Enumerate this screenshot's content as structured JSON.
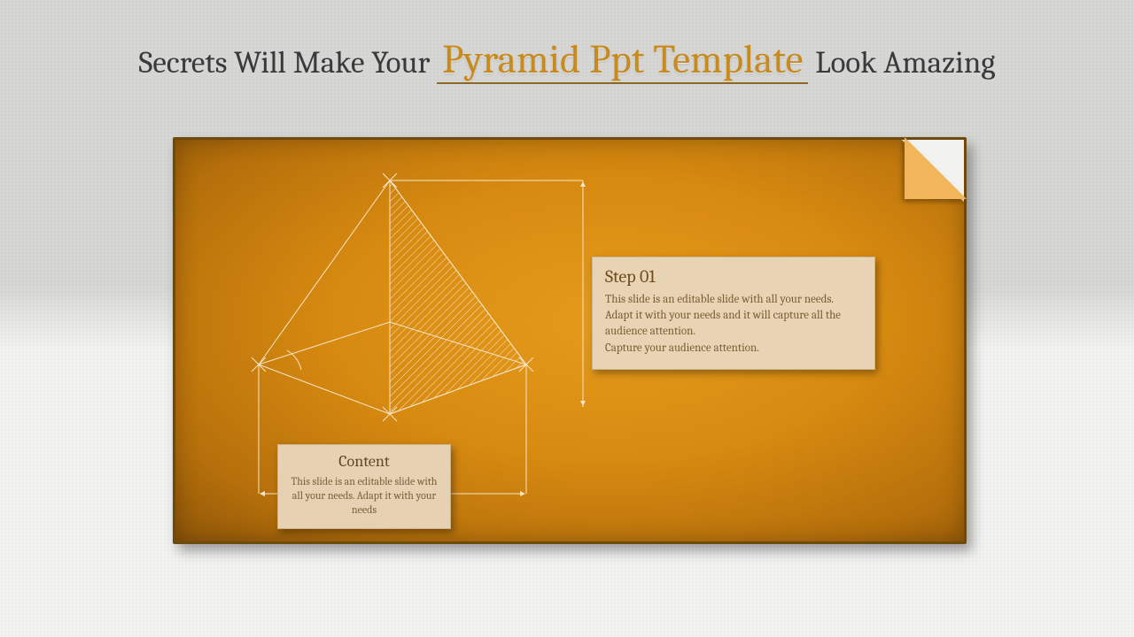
{
  "title": {
    "pre": "Secrets Will Make Your ",
    "accent": "Pyramid Ppt Template",
    "post": " Look Amazing"
  },
  "step": {
    "heading": "Step 01",
    "body": "This slide is an editable slide with all your needs.\nAdapt it with your needs and it will capture all the audience attention.\nCapture your audience attention."
  },
  "content": {
    "heading": "Content",
    "body": "This slide is an editable slide with all your needs. Adapt it with your needs"
  },
  "colors": {
    "accent": "#c78a1e",
    "board_border": "#6e4a0d",
    "box_bg": "#e8d4b5"
  }
}
